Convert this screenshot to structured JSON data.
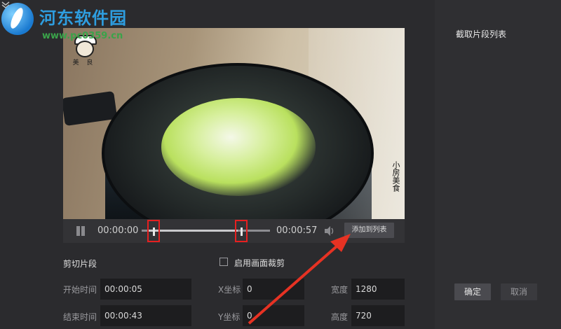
{
  "site_watermark": {
    "name": "河东软件园",
    "url": "www.pc0359.cn"
  },
  "video": {
    "watermark_top": "美 良",
    "watermark_side": "小房美食"
  },
  "player": {
    "current_time": "00:00:00",
    "total_time": "00:00:57",
    "add_to_list_label": "添加到列表",
    "trim_start_fraction": 0.05,
    "trim_end_fraction": 0.75
  },
  "form": {
    "section_title": "剪切片段",
    "start_label": "开始时间",
    "start_value": "00:00:05",
    "end_label": "结束时间",
    "end_value": "00:00:43",
    "crop_label": "启用画面裁剪",
    "x_label": "X坐标",
    "x_value": "0",
    "y_label": "Y坐标",
    "y_value": "0",
    "width_label": "宽度",
    "width_value": "1280",
    "height_label": "高度",
    "height_value": "720"
  },
  "right_panel": {
    "title": "截取片段列表",
    "confirm_label": "确定",
    "cancel_label": "取消"
  },
  "colors": {
    "marker": "#e62020",
    "arrow": "#e63223"
  }
}
